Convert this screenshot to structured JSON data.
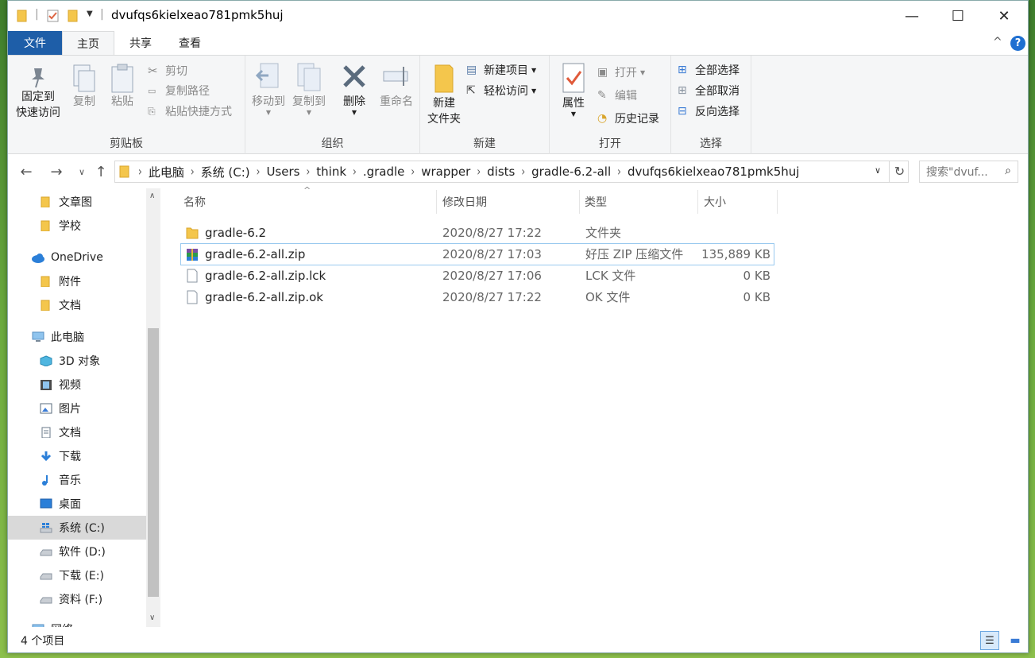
{
  "window": {
    "title": "dvufqs6kielxeao781pmk5huj",
    "controls": {
      "minimize": "—",
      "maximize": "☐",
      "close": "✕"
    }
  },
  "ribbon_tabs": {
    "file": "文件",
    "home": "主页",
    "share": "共享",
    "view": "查看"
  },
  "ribbon": {
    "clipboard": {
      "label": "剪贴板",
      "pin_line1": "固定到",
      "pin_line2": "快速访问",
      "copy": "复制",
      "paste": "粘贴",
      "cut": "剪切",
      "copy_path": "复制路径",
      "paste_shortcut": "粘贴快捷方式"
    },
    "organize": {
      "label": "组织",
      "move_to": "移动到",
      "copy_to": "复制到",
      "delete": "删除",
      "rename": "重命名"
    },
    "new": {
      "label": "新建",
      "new_folder_line1": "新建",
      "new_folder_line2": "文件夹",
      "new_item": "新建项目",
      "easy_access": "轻松访问"
    },
    "open": {
      "label": "打开",
      "properties": "属性",
      "open": "打开",
      "edit": "编辑",
      "history": "历史记录"
    },
    "select": {
      "label": "选择",
      "select_all": "全部选择",
      "select_none": "全部取消",
      "invert": "反向选择"
    }
  },
  "address": {
    "breadcrumbs": [
      "此电脑",
      "系统 (C:)",
      "Users",
      "think",
      ".gradle",
      "wrapper",
      "dists",
      "gradle-6.2-all",
      "dvufqs6kielxeao781pmk5huj"
    ],
    "search_placeholder": "搜索\"dvuf..."
  },
  "sidebar": {
    "items": [
      {
        "label": "文章图",
        "icon": "folder-icon"
      },
      {
        "label": "学校",
        "icon": "folder-icon"
      },
      {
        "label": "OneDrive",
        "icon": "cloud-icon"
      },
      {
        "label": "附件",
        "icon": "folder-icon"
      },
      {
        "label": "文档",
        "icon": "folder-icon"
      },
      {
        "label": "此电脑",
        "icon": "computer-icon"
      },
      {
        "label": "3D 对象",
        "icon": "cube-icon"
      },
      {
        "label": "视频",
        "icon": "film-icon"
      },
      {
        "label": "图片",
        "icon": "picture-icon"
      },
      {
        "label": "文档",
        "icon": "document-icon"
      },
      {
        "label": "下载",
        "icon": "download-arrow-icon"
      },
      {
        "label": "音乐",
        "icon": "music-note-icon"
      },
      {
        "label": "桌面",
        "icon": "desktop-icon"
      },
      {
        "label": "系统 (C:)",
        "icon": "windows-drive-icon"
      },
      {
        "label": "软件 (D:)",
        "icon": "drive-icon"
      },
      {
        "label": "下载 (E:)",
        "icon": "drive-icon"
      },
      {
        "label": "资料 (F:)",
        "icon": "drive-icon"
      },
      {
        "label": "网络",
        "icon": "network-icon"
      }
    ],
    "selected_index": 13
  },
  "file_list": {
    "columns": {
      "name": "名称",
      "date": "修改日期",
      "type": "类型",
      "size": "大小"
    },
    "rows": [
      {
        "name": "gradle-6.2",
        "date": "2020/8/27 17:22",
        "type": "文件夹",
        "size": "",
        "icon": "folder-icon"
      },
      {
        "name": "gradle-6.2-all.zip",
        "date": "2020/8/27 17:03",
        "type": "好压 ZIP 压缩文件",
        "size": "135,889 KB",
        "icon": "zip-archive-icon"
      },
      {
        "name": "gradle-6.2-all.zip.lck",
        "date": "2020/8/27 17:06",
        "type": "LCK 文件",
        "size": "0 KB",
        "icon": "blank-file-icon"
      },
      {
        "name": "gradle-6.2-all.zip.ok",
        "date": "2020/8/27 17:22",
        "type": "OK 文件",
        "size": "0 KB",
        "icon": "blank-file-icon"
      }
    ]
  },
  "status": {
    "count": "4 个项目"
  },
  "colors": {
    "accent": "#1e5ea8",
    "folder": "#f4c64c",
    "selection": "#d9d9d9"
  }
}
